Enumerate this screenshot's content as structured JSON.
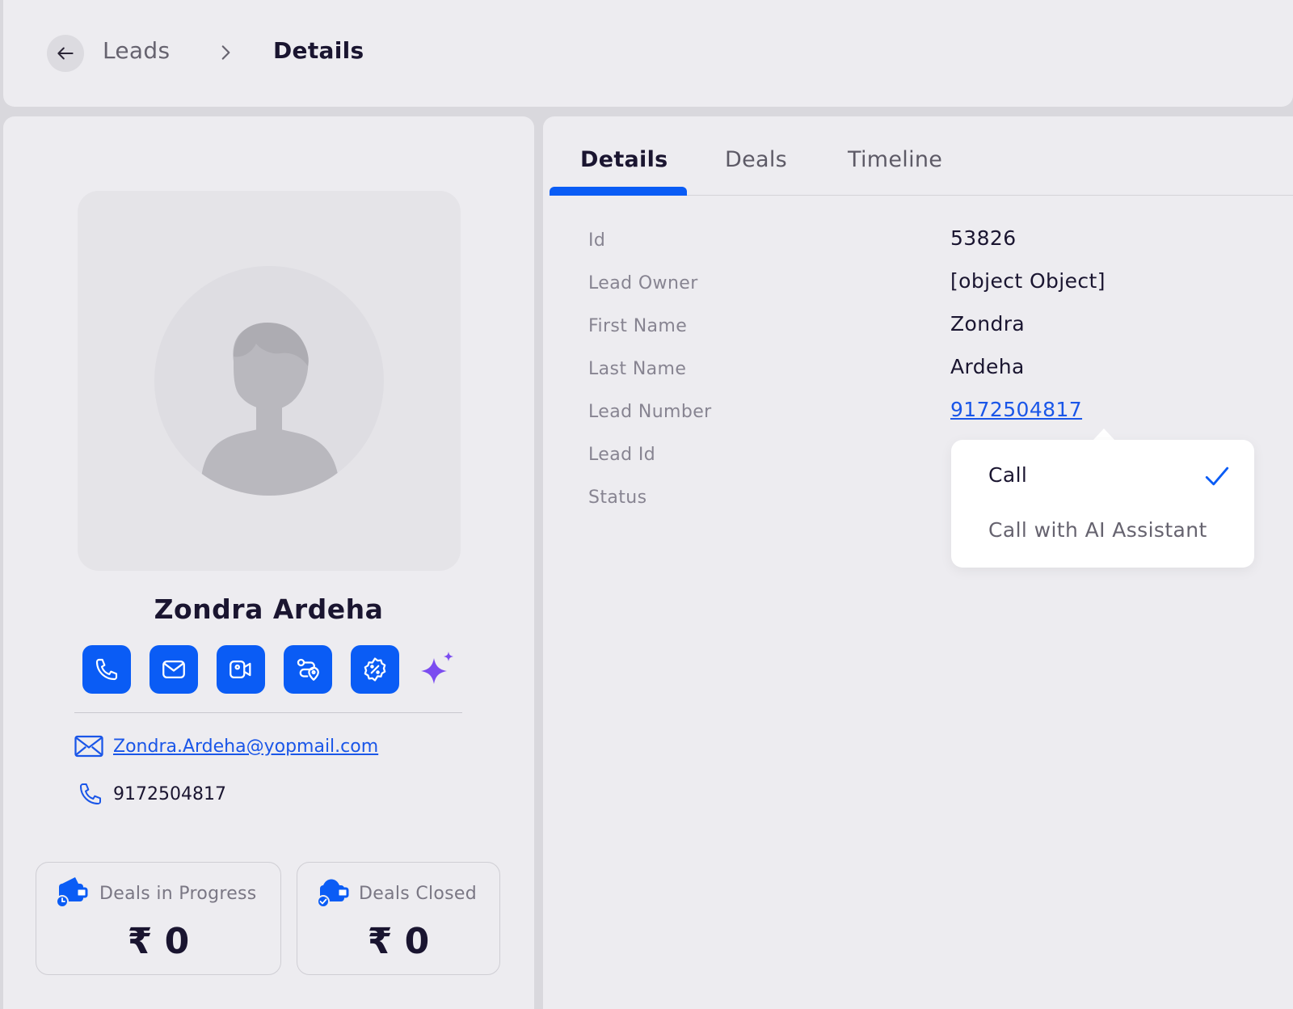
{
  "header": {
    "breadcrumb_parent": "Leads",
    "breadcrumb_current": "Details"
  },
  "profile": {
    "name": "Zondra Ardeha",
    "email": "Zondra.Ardeha@yopmail.com",
    "phone": "9172504817",
    "actions": [
      "phone-icon",
      "mail-icon",
      "video-icon",
      "route-icon",
      "discount-icon",
      "sparkle-icon"
    ]
  },
  "stats": {
    "in_progress": {
      "title": "Deals in Progress",
      "value": "₹ 0"
    },
    "closed": {
      "title": "Deals Closed",
      "value": "₹ 0"
    }
  },
  "tabs": {
    "details": "Details",
    "deals": "Deals",
    "timeline": "Timeline",
    "active": "Details"
  },
  "fields": {
    "id": {
      "label": "Id",
      "value": "53826"
    },
    "lead_owner": {
      "label": "Lead Owner",
      "value": "[object Object]"
    },
    "first_name": {
      "label": "First Name",
      "value": "Zondra"
    },
    "last_name": {
      "label": "Last Name",
      "value": "Ardeha"
    },
    "lead_number": {
      "label": "Lead Number",
      "value": "9172504817"
    },
    "lead_id": {
      "label": "Lead Id",
      "value": ""
    },
    "status": {
      "label": "Status",
      "value": ""
    }
  },
  "call_menu": {
    "items": [
      {
        "label": "Call",
        "selected": true
      },
      {
        "label": "Call with AI Assistant",
        "selected": false
      }
    ]
  },
  "colors": {
    "accent": "#0a5cf5",
    "link": "#1a56e8",
    "ai": "#7b4cf0"
  }
}
